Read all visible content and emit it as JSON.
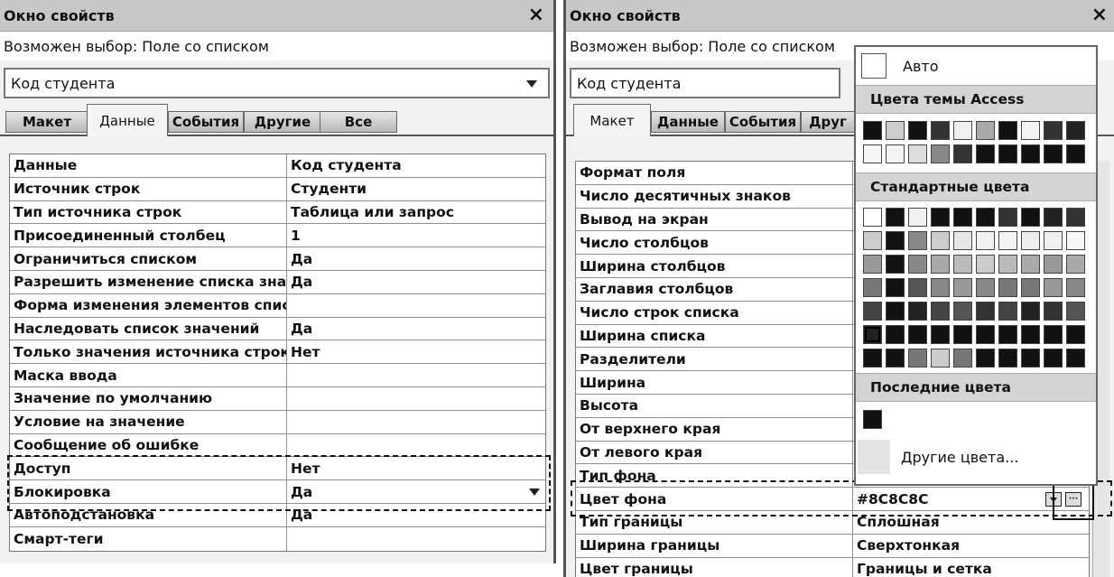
{
  "window_title": "Окно свойств",
  "close_glyph": "×",
  "selection_label": "Возможен выбор:  Поле со списком",
  "combo_value": "Код студента",
  "left": {
    "tabs": [
      "Макет",
      "Данные",
      "События",
      "Другие",
      "Все"
    ],
    "active_tab": "Данные",
    "rows": [
      {
        "key": "Данные",
        "value": "Код студента"
      },
      {
        "key": "Источник строк",
        "value": "Студенти"
      },
      {
        "key": "Тип источника строк",
        "value": "Таблица или запрос"
      },
      {
        "key": "Присоединенный столбец",
        "value": "1"
      },
      {
        "key": "Ограничиться списком",
        "value": "Да"
      },
      {
        "key": "Разрешить изменение списка значе",
        "value": "Да"
      },
      {
        "key": "Форма изменения элементов списк",
        "value": ""
      },
      {
        "key": "Наследовать список значений",
        "value": "Да"
      },
      {
        "key": "Только значения источника строк",
        "value": "Нет"
      },
      {
        "key": "Маска ввода",
        "value": ""
      },
      {
        "key": "Значение по умолчанию",
        "value": ""
      },
      {
        "key": "Условие на значение",
        "value": ""
      },
      {
        "key": "Сообщение об ошибке",
        "value": ""
      },
      {
        "key": "Доступ",
        "value": "Нет"
      },
      {
        "key": "Блокировка",
        "value": "Да"
      },
      {
        "key": "Автоподстановка",
        "value": "Да"
      },
      {
        "key": "Смарт-теги",
        "value": ""
      }
    ]
  },
  "right": {
    "tabs": [
      "Макет",
      "Данные",
      "События",
      "Друг"
    ],
    "active_tab": "Макет",
    "rows": [
      {
        "key": "Формат поля",
        "value": ""
      },
      {
        "key": "Число десятичных знаков",
        "value": ""
      },
      {
        "key": "Вывод на экран",
        "value": ""
      },
      {
        "key": "Число столбцов",
        "value": ""
      },
      {
        "key": "Ширина столбцов",
        "value": ""
      },
      {
        "key": "Заглавия столбцов",
        "value": ""
      },
      {
        "key": "Число строк списка",
        "value": ""
      },
      {
        "key": "Ширина списка",
        "value": ""
      },
      {
        "key": "Разделители",
        "value": ""
      },
      {
        "key": "Ширина",
        "value": ""
      },
      {
        "key": "Высота",
        "value": ""
      },
      {
        "key": "От верхнего края",
        "value": ""
      },
      {
        "key": "От левого края",
        "value": ""
      },
      {
        "key": "Тип фона",
        "value": ""
      },
      {
        "key": "Цвет фона",
        "value": "#8C8C8C"
      },
      {
        "key": "Тип границы",
        "value": "Сплошная"
      },
      {
        "key": "Ширина границы",
        "value": "Сверхтонкая"
      },
      {
        "key": "Цвет границы",
        "value": "Границы и сетка"
      }
    ]
  },
  "palette": {
    "auto_label": "Авто",
    "theme_header": "Цвета темы Access",
    "standard_header": "Стандартные цвета",
    "recent_header": "Последние цвета",
    "more_label": "Другие цвета...",
    "theme_colors": [
      [
        "#111111",
        "#cccccc",
        "#111111",
        "#333333",
        "#f0f0f0",
        "#aaaaaa",
        "#111111",
        "#f4f4f4",
        "#333333",
        "#222222"
      ],
      [
        "#f6f6f6",
        "#f4f4f4",
        "#dddddd",
        "#888888",
        "#333333",
        "#111111",
        "#111111",
        "#111111",
        "#111111",
        "#111111"
      ]
    ],
    "standard_colors": [
      [
        "#ffffff",
        "#111111",
        "#f0f0f0",
        "#111111",
        "#111111",
        "#111111",
        "#333333",
        "#111111",
        "#222222",
        "#333333"
      ],
      [
        "#cccccc",
        "#111111",
        "#888888",
        "#cccccc",
        "#e6e6e6",
        "#f2f2f2",
        "#f4f4f4",
        "#eeeeee",
        "#f0f0f0",
        "#f7f7f7"
      ],
      [
        "#999999",
        "#111111",
        "#888888",
        "#aaaaaa",
        "#bbbbbb",
        "#cccccc",
        "#bbbbbb",
        "#aaaaaa",
        "#999999",
        "#aaaaaa"
      ],
      [
        "#777777",
        "#111111",
        "#555555",
        "#888888",
        "#999999",
        "#888888",
        "#777777",
        "#777777",
        "#999999",
        "#888888"
      ],
      [
        "#444444",
        "#111111",
        "#222222",
        "#444444",
        "#555555",
        "#333333",
        "#444444",
        "#222222",
        "#333333",
        "#555555"
      ],
      [
        "#202020",
        "#111111",
        "#111111",
        "#111111",
        "#111111",
        "#111111",
        "#111111",
        "#111111",
        "#111111",
        "#111111"
      ],
      [
        "#111111",
        "#111111",
        "#777777",
        "#cccccc",
        "#777777",
        "#111111",
        "#111111",
        "#111111",
        "#111111",
        "#111111"
      ]
    ],
    "recent_colors": [
      "#111111"
    ]
  }
}
